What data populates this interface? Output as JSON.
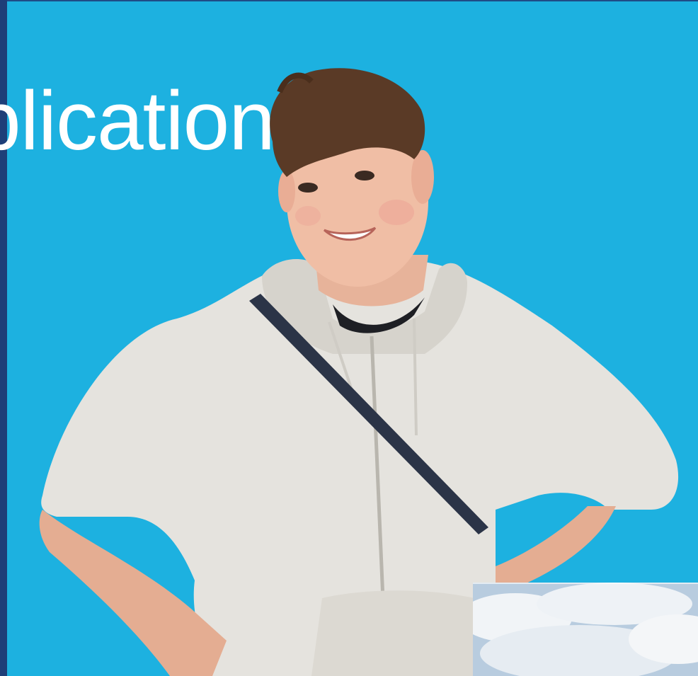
{
  "slide": {
    "headline": "plication"
  },
  "colors": {
    "background": "#1db1e0",
    "border": "#1e3f78",
    "headline": "#ffffff",
    "hoodie": "#e4e2dd",
    "strap": "#2b3447",
    "hair": "#5a3a26",
    "skin": "#e8b49b"
  },
  "icons": {
    "photo": "person-photo",
    "thumbnail": "sky-clouds-thumbnail"
  }
}
